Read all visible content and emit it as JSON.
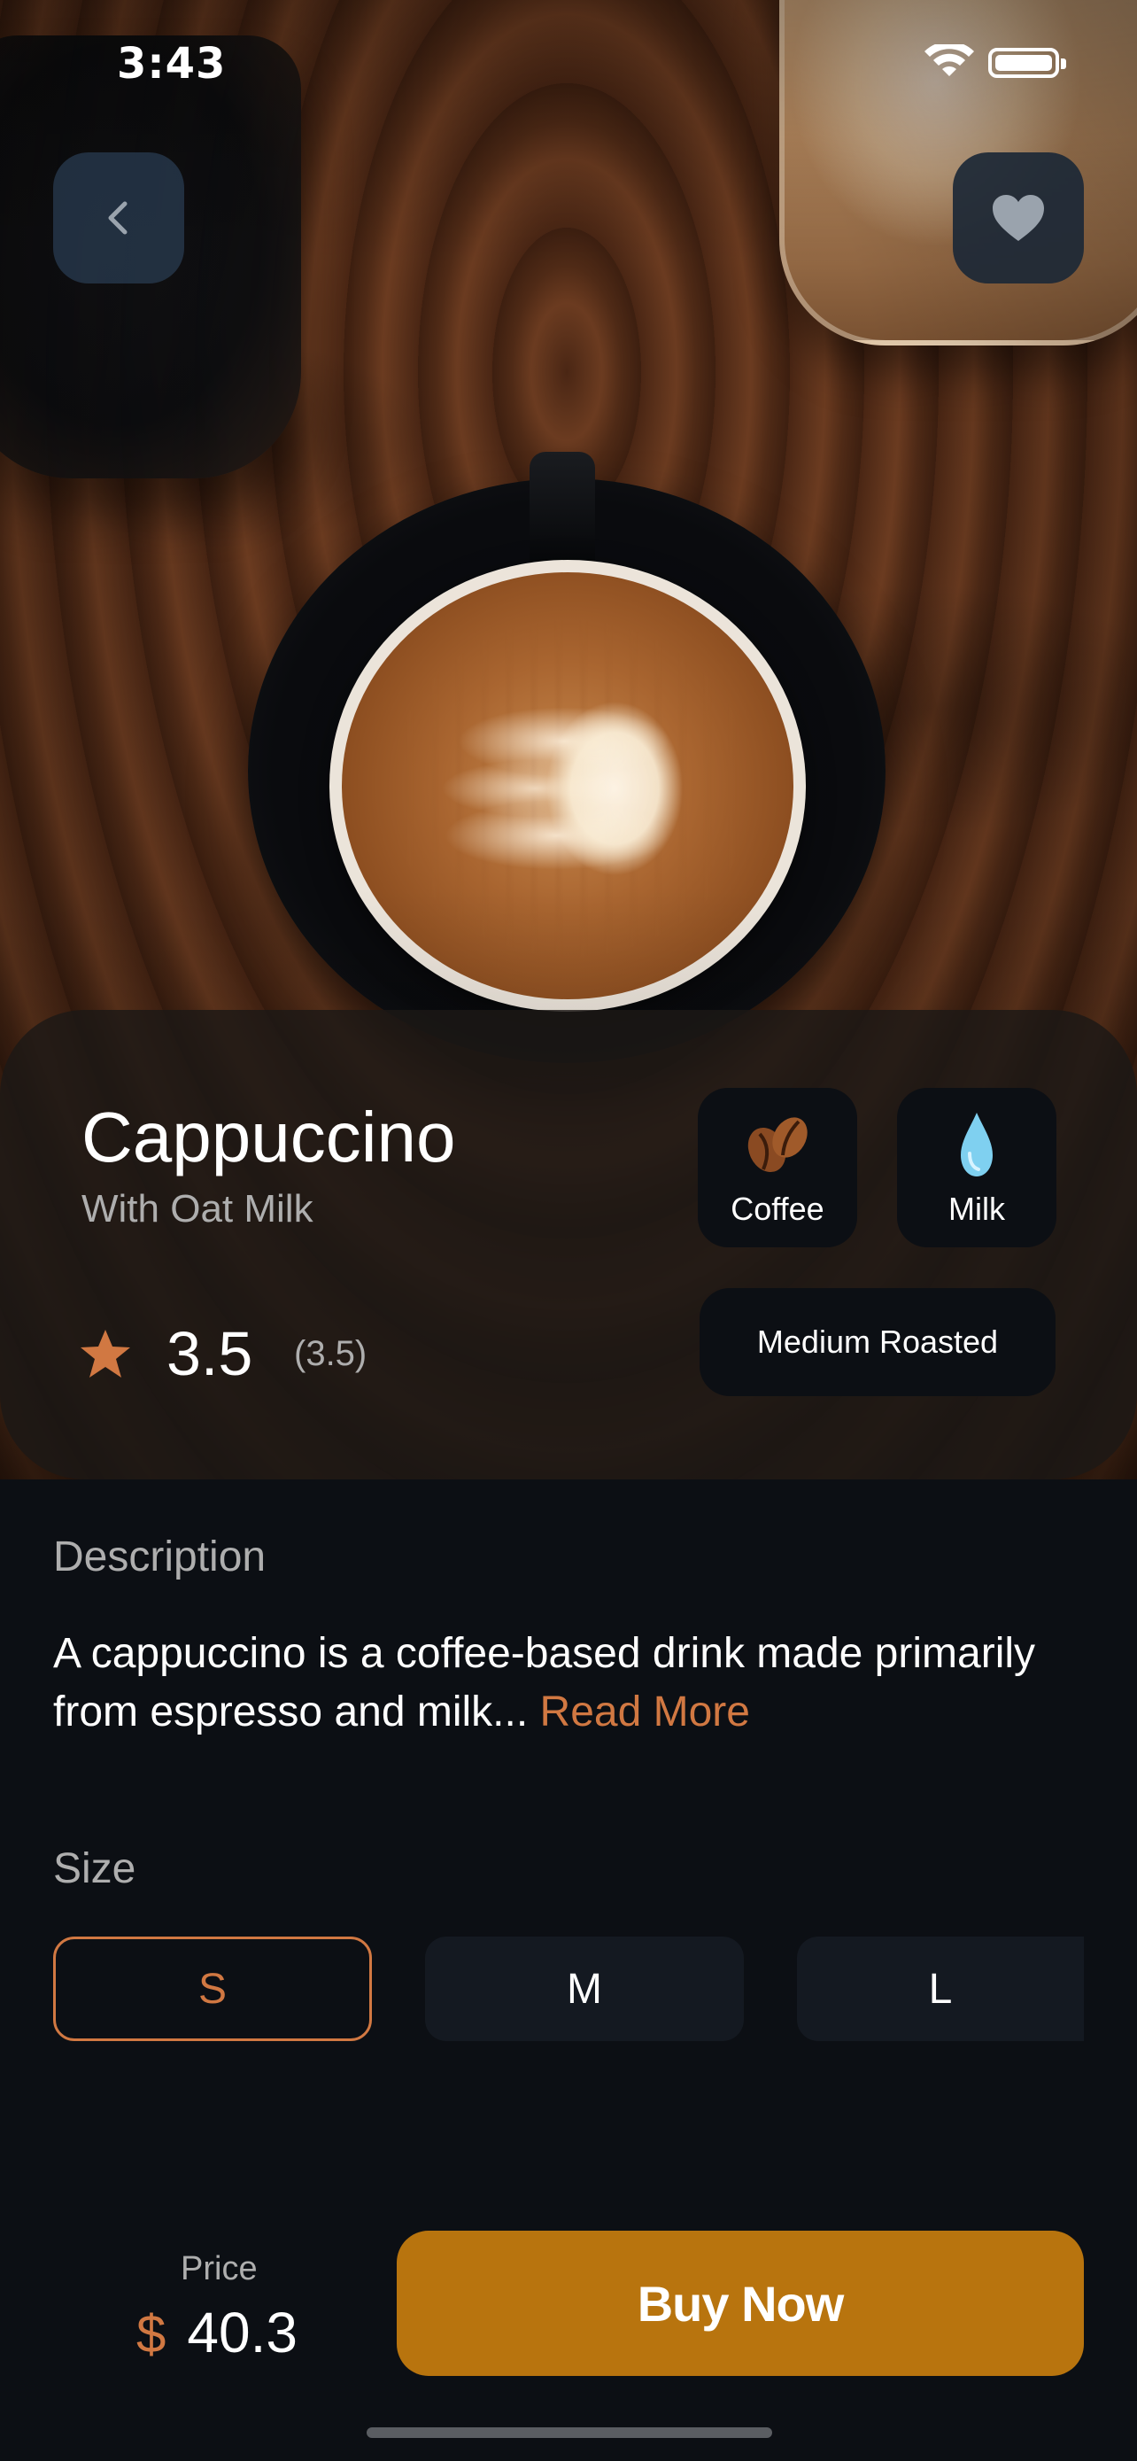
{
  "status_bar": {
    "time": "3:43"
  },
  "header": {
    "back_icon": "chevron-left-icon",
    "favorite_icon": "heart-icon"
  },
  "product": {
    "name": "Cappuccino",
    "variant": "With Oat Milk",
    "rating": "3.5",
    "rating_count": "(3.5)",
    "tags": [
      {
        "label": "Coffee",
        "icon": "coffee-bean-icon"
      },
      {
        "label": "Milk",
        "icon": "milk-drop-icon"
      }
    ],
    "roast": "Medium Roasted"
  },
  "description": {
    "label": "Description",
    "text": "A cappuccino is a coffee-based drink made primarily from espresso and milk...",
    "read_more": "Read More"
  },
  "size": {
    "label": "Size",
    "options": [
      "S",
      "M",
      "L"
    ],
    "selected": "S"
  },
  "footer": {
    "price_label": "Price",
    "currency": "$",
    "price": "40.3",
    "buy_label": "Buy Now"
  },
  "colors": {
    "background": "#0C0F14",
    "accent": "#D17842",
    "button": "#B8740E",
    "chip": "#141921"
  }
}
